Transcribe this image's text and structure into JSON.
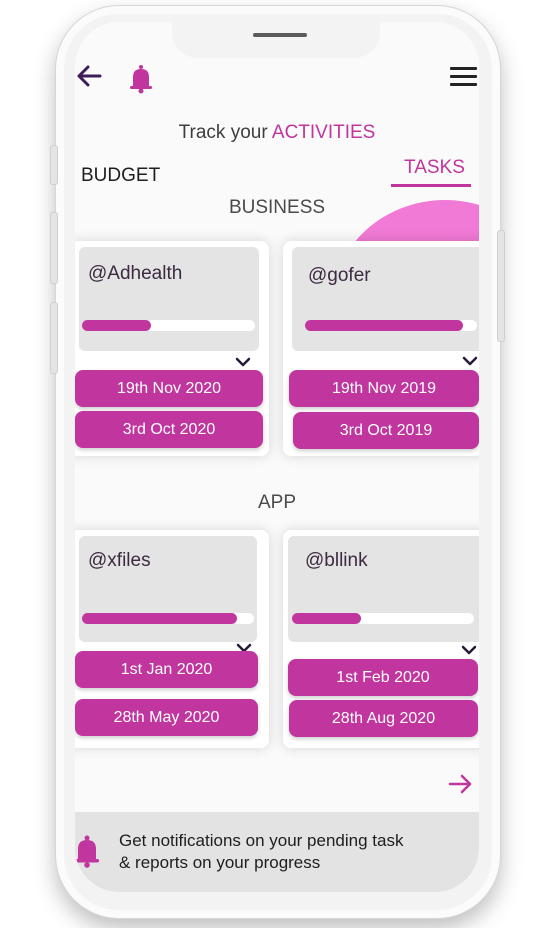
{
  "header": {
    "title_prefix": "Track your ",
    "title_accent": "ACTIVITIES"
  },
  "tabs": {
    "left_label": "BUDGET",
    "right_label": "TASKS",
    "active": "TASKS"
  },
  "sections": [
    {
      "label": "BUSINESS",
      "projects": [
        {
          "handle": "@Adhealth",
          "progress": 0.4,
          "start_date": "19th Nov 2020",
          "end_date": "3rd Oct 2020"
        },
        {
          "handle": "@gofer",
          "progress": 0.92,
          "start_date": "19th Nov 2019",
          "end_date": "3rd Oct 2019"
        }
      ]
    },
    {
      "label": "APP",
      "projects": [
        {
          "handle": "@xfiles",
          "progress": 0.9,
          "start_date": "1st Jan 2020",
          "end_date": "28th May 2020"
        },
        {
          "handle": "@bllink",
          "progress": 0.38,
          "start_date": "1st Feb 2020",
          "end_date": "28th Aug 2020"
        }
      ]
    }
  ],
  "footer": {
    "message_line1": "Get notifications on your pending task",
    "message_line2": "& reports on your progress"
  },
  "icons": {
    "back": "arrow-left-icon",
    "notification": "bell-icon",
    "menu": "hamburger-menu-icon",
    "next": "arrow-right-icon",
    "expand": "chevron-down-icon"
  },
  "colors": {
    "accent": "#c0359e",
    "accent_light": "#f07ad6",
    "card_inner": "#e4e4e4",
    "footer_bg": "#e3e3e3"
  }
}
